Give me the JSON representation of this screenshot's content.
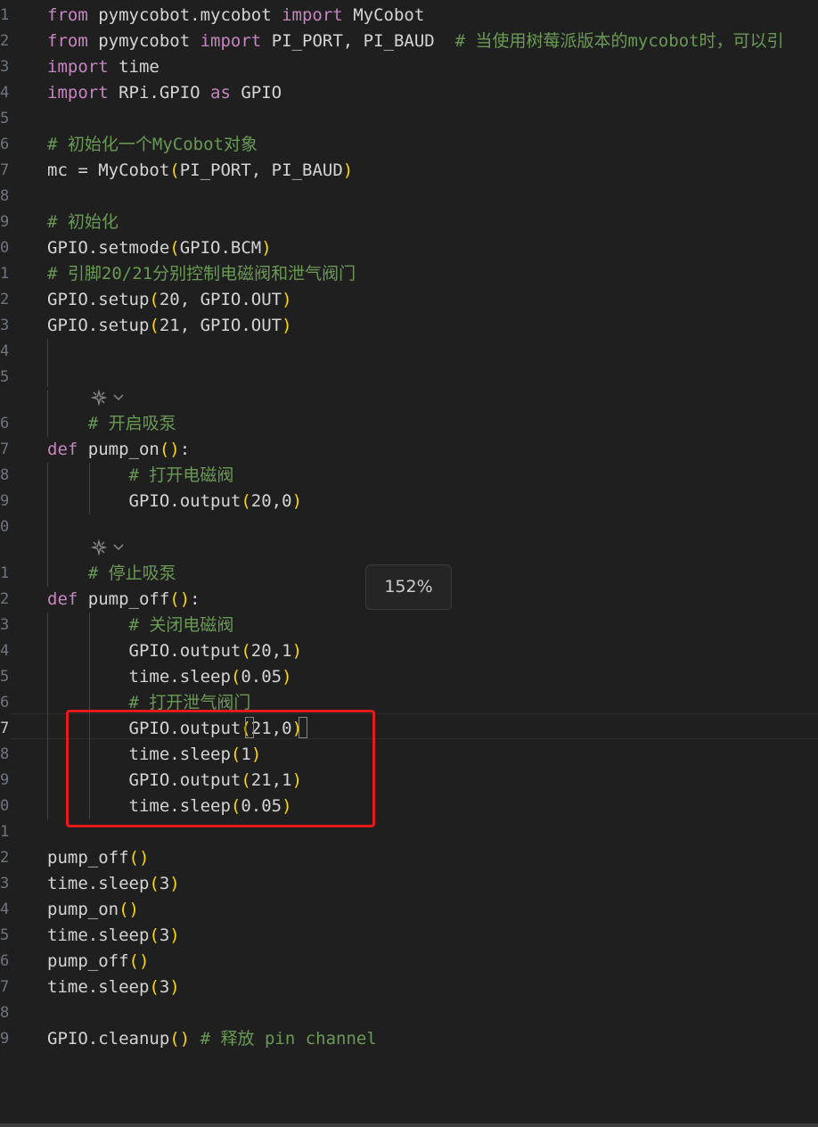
{
  "editor": {
    "lines": [
      {
        "ln": "1",
        "tokens": [
          [
            "kw",
            "from"
          ],
          [
            "tx",
            " pymycobot.mycobot "
          ],
          [
            "kw",
            "import"
          ],
          [
            "tx",
            " MyCobot"
          ]
        ]
      },
      {
        "ln": "2",
        "tokens": [
          [
            "kw",
            "from"
          ],
          [
            "tx",
            " pymycobot "
          ],
          [
            "kw",
            "import"
          ],
          [
            "tx",
            " PI_PORT, PI_BAUD  "
          ],
          [
            "cm",
            "# 当使用树莓派版本的mycobot时，可以引"
          ]
        ]
      },
      {
        "ln": "3",
        "tokens": [
          [
            "kw",
            "import"
          ],
          [
            "tx",
            " time"
          ]
        ]
      },
      {
        "ln": "4",
        "tokens": [
          [
            "kw",
            "import"
          ],
          [
            "tx",
            " RPi.GPIO "
          ],
          [
            "kw",
            "as"
          ],
          [
            "tx",
            " GPIO"
          ]
        ]
      },
      {
        "ln": "5",
        "tokens": []
      },
      {
        "ln": "6",
        "tokens": [
          [
            "cm",
            "# 初始化一个MyCobot对象"
          ]
        ]
      },
      {
        "ln": "7",
        "tokens": [
          [
            "tx",
            "mc = MyCobot"
          ],
          [
            "p1",
            "("
          ],
          [
            "tx",
            "PI_PORT, PI_BAUD"
          ],
          [
            "p1",
            ")"
          ]
        ]
      },
      {
        "ln": "8",
        "tokens": []
      },
      {
        "ln": "9",
        "tokens": [
          [
            "cm",
            "# 初始化"
          ]
        ]
      },
      {
        "ln": "0",
        "tokens": [
          [
            "tx",
            "GPIO.setmode"
          ],
          [
            "p1",
            "("
          ],
          [
            "tx",
            "GPIO.BCM"
          ],
          [
            "p1",
            ")"
          ]
        ]
      },
      {
        "ln": "1",
        "tokens": [
          [
            "cm",
            "# 引脚20/21分别控制电磁阀和泄气阀门"
          ]
        ]
      },
      {
        "ln": "2",
        "tokens": [
          [
            "tx",
            "GPIO.setup"
          ],
          [
            "p1",
            "("
          ],
          [
            "tx",
            "20, GPIO.OUT"
          ],
          [
            "p1",
            ")"
          ]
        ]
      },
      {
        "ln": "3",
        "tokens": [
          [
            "tx",
            "GPIO.setup"
          ],
          [
            "p1",
            "("
          ],
          [
            "tx",
            "21, GPIO.OUT"
          ],
          [
            "p1",
            ")"
          ]
        ]
      },
      {
        "ln": "4",
        "tokens": []
      },
      {
        "ln": "5",
        "tokens": []
      },
      {
        "ln": "6",
        "tokens": [
          [
            "cm",
            "    # 开启吸泵"
          ]
        ]
      },
      {
        "ln": "7",
        "tokens": [
          [
            "kw",
            "def"
          ],
          [
            "tx",
            " pump_on"
          ],
          [
            "p1",
            "()"
          ],
          [
            "tx",
            ":"
          ]
        ]
      },
      {
        "ln": "8",
        "tokens": [
          [
            "cm",
            "        # 打开电磁阀"
          ]
        ]
      },
      {
        "ln": "9",
        "tokens": [
          [
            "tx",
            "        GPIO.output"
          ],
          [
            "p1",
            "("
          ],
          [
            "tx",
            "20,0"
          ],
          [
            "p1",
            ")"
          ]
        ]
      },
      {
        "ln": "0",
        "tokens": []
      },
      {
        "ln": "1",
        "tokens": [
          [
            "cm",
            "    # 停止吸泵"
          ]
        ]
      },
      {
        "ln": "2",
        "tokens": [
          [
            "kw",
            "def"
          ],
          [
            "tx",
            " pump_off"
          ],
          [
            "p1",
            "()"
          ],
          [
            "tx",
            ":"
          ]
        ]
      },
      {
        "ln": "3",
        "tokens": [
          [
            "cm",
            "        # 关闭电磁阀"
          ]
        ]
      },
      {
        "ln": "4",
        "tokens": [
          [
            "tx",
            "        GPIO.output"
          ],
          [
            "p1",
            "("
          ],
          [
            "tx",
            "20,1"
          ],
          [
            "p1",
            ")"
          ]
        ]
      },
      {
        "ln": "5",
        "tokens": [
          [
            "tx",
            "        time.sleep"
          ],
          [
            "p1",
            "("
          ],
          [
            "tx",
            "0.05"
          ],
          [
            "p1",
            ")"
          ]
        ]
      },
      {
        "ln": "6",
        "tokens": [
          [
            "cm",
            "        # 打开泄气阀门"
          ]
        ]
      },
      {
        "ln": "7",
        "tokens": [
          [
            "tx",
            "        GPIO.output"
          ],
          [
            "p1",
            "("
          ],
          [
            "tx",
            "21,0"
          ],
          [
            "p1",
            ")"
          ]
        ]
      },
      {
        "ln": "8",
        "tokens": [
          [
            "tx",
            "        time.sleep"
          ],
          [
            "p1",
            "("
          ],
          [
            "tx",
            "1"
          ],
          [
            "p1",
            ")"
          ]
        ]
      },
      {
        "ln": "9",
        "tokens": [
          [
            "tx",
            "        GPIO.output"
          ],
          [
            "p1",
            "("
          ],
          [
            "tx",
            "21,1"
          ],
          [
            "p1",
            ")"
          ]
        ]
      },
      {
        "ln": "0",
        "tokens": [
          [
            "tx",
            "        time.sleep"
          ],
          [
            "p1",
            "("
          ],
          [
            "tx",
            "0.05"
          ],
          [
            "p1",
            ")"
          ]
        ]
      },
      {
        "ln": "1",
        "tokens": []
      },
      {
        "ln": "2",
        "tokens": [
          [
            "tx",
            "pump_off"
          ],
          [
            "p1",
            "()"
          ]
        ]
      },
      {
        "ln": "3",
        "tokens": [
          [
            "tx",
            "time.sleep"
          ],
          [
            "p1",
            "("
          ],
          [
            "tx",
            "3"
          ],
          [
            "p1",
            ")"
          ]
        ]
      },
      {
        "ln": "4",
        "tokens": [
          [
            "tx",
            "pump_on"
          ],
          [
            "p1",
            "()"
          ]
        ]
      },
      {
        "ln": "5",
        "tokens": [
          [
            "tx",
            "time.sleep"
          ],
          [
            "p1",
            "("
          ],
          [
            "tx",
            "3"
          ],
          [
            "p1",
            ")"
          ]
        ]
      },
      {
        "ln": "6",
        "tokens": [
          [
            "tx",
            "pump_off"
          ],
          [
            "p1",
            "()"
          ]
        ]
      },
      {
        "ln": "7",
        "tokens": [
          [
            "tx",
            "time.sleep"
          ],
          [
            "p1",
            "("
          ],
          [
            "tx",
            "3"
          ],
          [
            "p1",
            ")"
          ]
        ]
      },
      {
        "ln": "8",
        "tokens": []
      },
      {
        "ln": "9",
        "tokens": [
          [
            "tx",
            "GPIO.cleanup"
          ],
          [
            "p1",
            "()"
          ],
          [
            "tx",
            " "
          ],
          [
            "cm",
            "# 释放 pin channel"
          ]
        ]
      }
    ],
    "active_line_index": 26,
    "codelens_icon": "sparkle-icon",
    "codelens_chevron": "chevron-down-icon"
  },
  "zoom": {
    "label": "152%"
  },
  "colors": {
    "background": "#1f1f1f",
    "keyword": "#c586c0",
    "comment": "#6a9955",
    "bracket": "#ffd700",
    "highlight_box": "#e31b1b"
  }
}
